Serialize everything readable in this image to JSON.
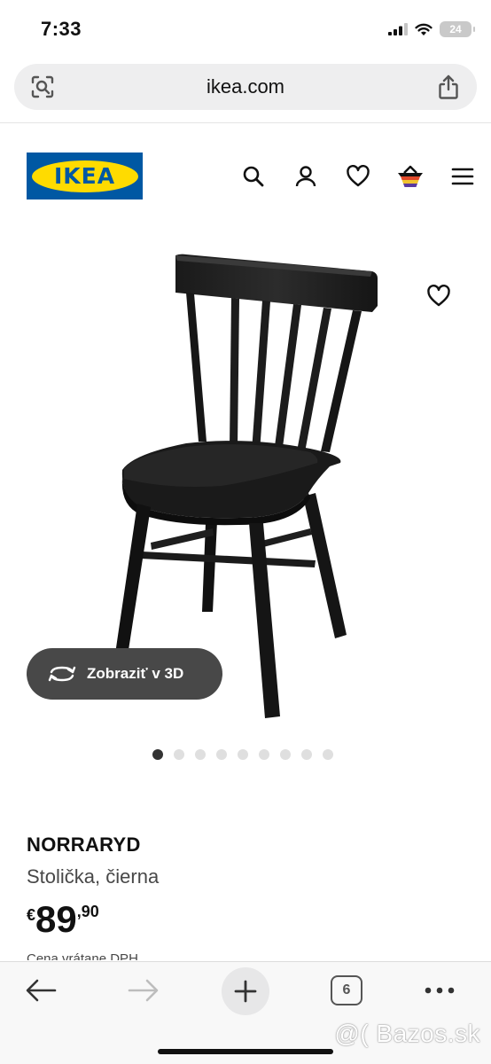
{
  "status_bar": {
    "time": "7:33",
    "battery": "24"
  },
  "browser": {
    "url": "ikea.com",
    "tab_count": "6"
  },
  "header": {
    "logo_text": "IKEA",
    "icons": [
      "search-icon",
      "account-icon",
      "favourites-icon",
      "cart-icon",
      "menu-icon"
    ]
  },
  "gallery": {
    "view_3d_label": "Zobraziť v 3D",
    "image_count": 9,
    "active_index": 0
  },
  "product": {
    "name": "NORRARYD",
    "description": "Stolička, čierna",
    "price_currency": "€",
    "price_integer": "89",
    "price_decimal": ",90",
    "price_note": "Cena vrátane DPH"
  },
  "watermark": "@( Bazos.sk",
  "colors": {
    "ikea_blue": "#0058a3",
    "ikea_yellow": "#ffdb00",
    "button_dark": "#484848"
  }
}
